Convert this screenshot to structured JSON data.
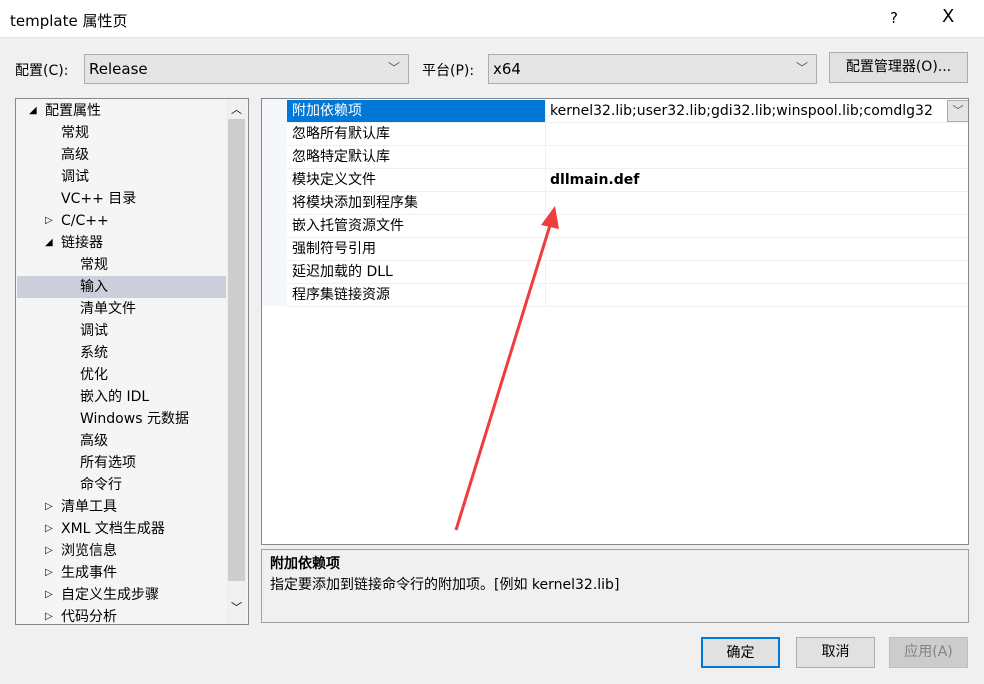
{
  "window": {
    "title": "template 属性页",
    "help": "?",
    "close": "X"
  },
  "toolbar": {
    "config_label": "配置(C):",
    "config_value": "Release",
    "platform_label": "平台(P):",
    "platform_value": "x64",
    "config_manager": "配置管理器(O)..."
  },
  "tree": {
    "items": [
      {
        "label": "配置属性",
        "level": 0,
        "expander": "expanded"
      },
      {
        "label": "常规",
        "level": 1
      },
      {
        "label": "高级",
        "level": 1
      },
      {
        "label": "调试",
        "level": 1
      },
      {
        "label": "VC++ 目录",
        "level": 1
      },
      {
        "label": "C/C++",
        "level": 1,
        "expander": "collapsed"
      },
      {
        "label": "链接器",
        "level": 1,
        "expander": "expanded"
      },
      {
        "label": "常规",
        "level": 2
      },
      {
        "label": "输入",
        "level": 2,
        "selected": true
      },
      {
        "label": "清单文件",
        "level": 2
      },
      {
        "label": "调试",
        "level": 2
      },
      {
        "label": "系统",
        "level": 2
      },
      {
        "label": "优化",
        "level": 2
      },
      {
        "label": "嵌入的 IDL",
        "level": 2
      },
      {
        "label": "Windows 元数据",
        "level": 2
      },
      {
        "label": "高级",
        "level": 2
      },
      {
        "label": "所有选项",
        "level": 2
      },
      {
        "label": "命令行",
        "level": 2
      },
      {
        "label": "清单工具",
        "level": 1,
        "expander": "collapsed"
      },
      {
        "label": "XML 文档生成器",
        "level": 1,
        "expander": "collapsed"
      },
      {
        "label": "浏览信息",
        "level": 1,
        "expander": "collapsed"
      },
      {
        "label": "生成事件",
        "level": 1,
        "expander": "collapsed"
      },
      {
        "label": "自定义生成步骤",
        "level": 1,
        "expander": "collapsed"
      },
      {
        "label": "代码分析",
        "level": 1,
        "expander": "collapsed"
      }
    ]
  },
  "grid": {
    "rows": [
      {
        "name": "附加依赖项",
        "value": "kernel32.lib;user32.lib;gdi32.lib;winspool.lib;comdlg32",
        "selected": true
      },
      {
        "name": "忽略所有默认库",
        "value": ""
      },
      {
        "name": "忽略特定默认库",
        "value": ""
      },
      {
        "name": "模块定义文件",
        "value": "dllmain.def",
        "bold": true
      },
      {
        "name": "将模块添加到程序集",
        "value": ""
      },
      {
        "name": "嵌入托管资源文件",
        "value": ""
      },
      {
        "name": "强制符号引用",
        "value": ""
      },
      {
        "name": "延迟加载的 DLL",
        "value": ""
      },
      {
        "name": "程序集链接资源",
        "value": ""
      }
    ]
  },
  "description": {
    "title": "附加依赖项",
    "text": "指定要添加到链接命令行的附加项。[例如 kernel32.lib]"
  },
  "buttons": {
    "ok": "确定",
    "cancel": "取消",
    "apply": "应用(A)"
  },
  "colors": {
    "selection": "#0078d7",
    "annotation_arrow": "#f03c3c"
  }
}
